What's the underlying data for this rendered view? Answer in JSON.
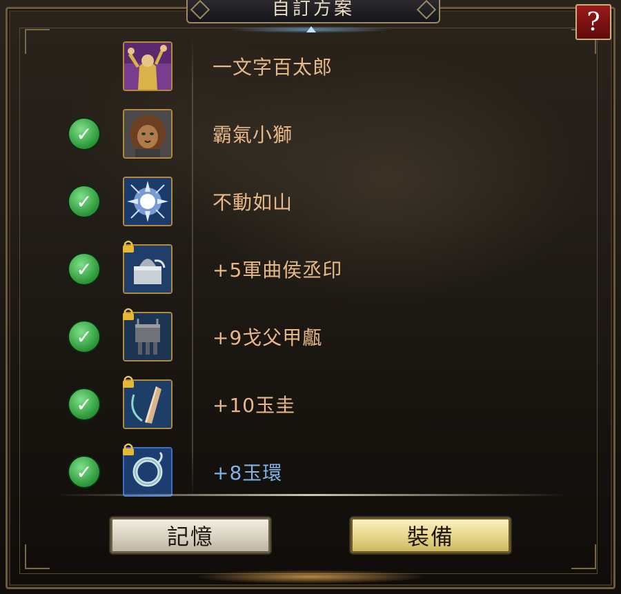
{
  "header": {
    "title": "自訂方案",
    "help_label": "?"
  },
  "rows": [
    {
      "checked": false,
      "locked": false,
      "icon": "hero-portrait-icon",
      "label": "一文字百太郎",
      "label_color": "#e8b889"
    },
    {
      "checked": true,
      "locked": false,
      "icon": "lion-pet-icon",
      "label": "霸氣小獅",
      "label_color": "#e8b889"
    },
    {
      "checked": true,
      "locked": false,
      "icon": "lightning-orb-icon",
      "label": "不動如山",
      "label_color": "#e8b889"
    },
    {
      "checked": true,
      "locked": true,
      "icon": "seal-item-icon",
      "label": "+5軍曲侯丞印",
      "label_color": "#e8b889"
    },
    {
      "checked": true,
      "locked": true,
      "icon": "bronze-vessel-icon",
      "label": "+9戈父甲甗",
      "label_color": "#e8b889"
    },
    {
      "checked": true,
      "locked": true,
      "icon": "jade-tablet-icon",
      "label": "+10玉圭",
      "label_color": "#e8b889"
    },
    {
      "checked": true,
      "locked": true,
      "icon": "jade-ring-icon",
      "label": "+8玉環",
      "label_color": "#7fb2e6"
    }
  ],
  "buttons": {
    "memory_label": "記憶",
    "equip_label": "裝備"
  },
  "colors": {
    "frame_gold": "#b48a3a",
    "check_green": "#2f9a3c",
    "help_red": "#9c1a1a"
  }
}
